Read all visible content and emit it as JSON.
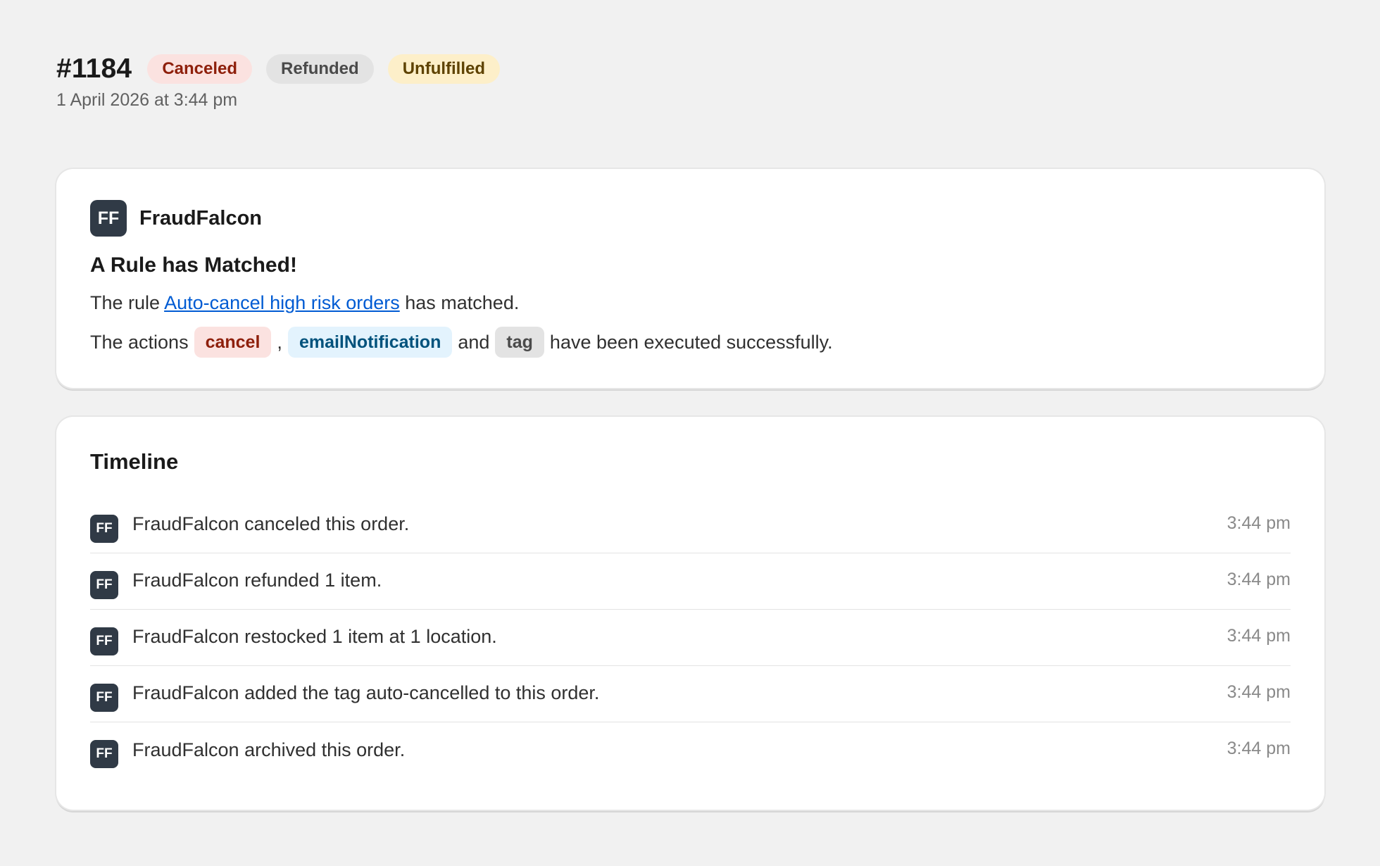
{
  "order": {
    "number": "#1184",
    "date": "1 April 2026 at 3:44 pm",
    "badges": [
      {
        "label": "Canceled",
        "color": "#8e1f0b",
        "bg": "#fbe2e0"
      },
      {
        "label": "Refunded",
        "color": "#4a4a4a",
        "bg": "#e3e3e3"
      },
      {
        "label": "Unfulfilled",
        "color": "#5e4200",
        "bg": "#fdefc9"
      }
    ]
  },
  "app_card": {
    "avatar": "FF",
    "app_name": "FraudFalcon",
    "heading": "A Rule has Matched!",
    "rule_prefix": "The rule",
    "rule_link": "Auto-cancel high risk orders",
    "rule_suffix": "has matched.",
    "actions_prefix": "The actions",
    "actions": [
      "cancel",
      "emailNotification",
      "tag"
    ],
    "comma": ",",
    "and": "and",
    "actions_suffix": "have been executed successfully."
  },
  "timeline": {
    "title": "Timeline",
    "avatar": "FF",
    "events": [
      {
        "text": "FraudFalcon canceled this order.",
        "time": "3:44 pm"
      },
      {
        "text": "FraudFalcon refunded 1 item.",
        "time": "3:44 pm"
      },
      {
        "text": "FraudFalcon restocked 1 item at 1 location.",
        "time": "3:44 pm"
      },
      {
        "text": "FraudFalcon added the tag auto-cancelled to this order.",
        "time": "3:44 pm"
      },
      {
        "text": "FraudFalcon archived this order.",
        "time": "3:44 pm"
      }
    ]
  },
  "colors": {
    "page_bg": "#f1f1f1",
    "card_bg": "#ffffff",
    "avatar_bg": "#303a46",
    "link": "#005bd3"
  }
}
